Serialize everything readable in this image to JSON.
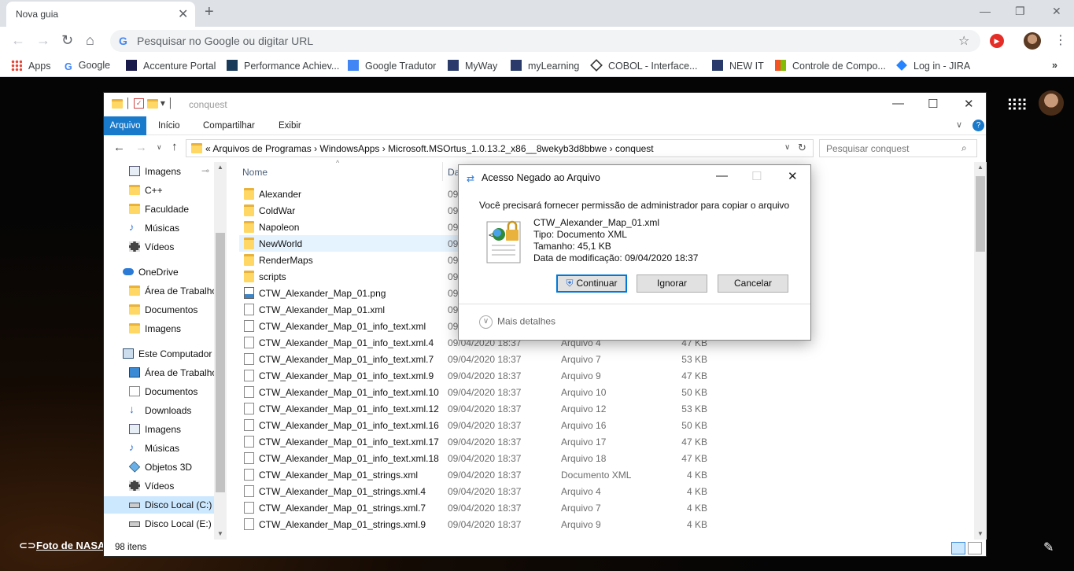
{
  "browser": {
    "tab_title": "Nova guia",
    "omnibox_placeholder": "Pesquisar no Google ou digitar URL",
    "bookmarks": [
      "Apps",
      "Google",
      "Accenture Portal",
      "Performance Achiev...",
      "Google Tradutor",
      "MyWay",
      "myLearning",
      "COBOL - Interface...",
      "NEW IT",
      "Controle de Compo...",
      "Log in - JIRA"
    ]
  },
  "desktop": {
    "photo_credit": "Foto de NASA"
  },
  "explorer": {
    "title": "conquest",
    "ribbon_tabs": [
      "Arquivo",
      "Início",
      "Compartilhar",
      "Exibir"
    ],
    "breadcrumb": "«  Arquivos de Programas  ›  WindowsApps  ›  Microsoft.MSOrtus_1.0.13.2_x86__8wekyb3d8bbwe  ›  conquest",
    "search_placeholder": "Pesquisar conquest",
    "nav": [
      "Imagens",
      "C++",
      "Faculdade",
      "Músicas",
      "Vídeos",
      "OneDrive",
      "Área de Trabalho",
      "Documentos",
      "Imagens",
      "Este Computador",
      "Área de Trabalho",
      "Documentos",
      "Downloads",
      "Imagens",
      "Músicas",
      "Objetos 3D",
      "Vídeos",
      "Disco Local (C:)",
      "Disco Local (E:)"
    ],
    "columns": {
      "name": "Nome",
      "date": "Da"
    },
    "files": [
      {
        "name": "Alexander",
        "date": "09",
        "type": "",
        "size": ""
      },
      {
        "name": "ColdWar",
        "date": "09",
        "type": "",
        "size": ""
      },
      {
        "name": "Napoleon",
        "date": "09",
        "type": "",
        "size": ""
      },
      {
        "name": "NewWorld",
        "date": "09",
        "type": "",
        "size": ""
      },
      {
        "name": "RenderMaps",
        "date": "09",
        "type": "",
        "size": ""
      },
      {
        "name": "scripts",
        "date": "09",
        "type": "",
        "size": ""
      },
      {
        "name": "CTW_Alexander_Map_01.png",
        "date": "09",
        "type": "",
        "size": ""
      },
      {
        "name": "CTW_Alexander_Map_01.xml",
        "date": "09",
        "type": "",
        "size": ""
      },
      {
        "name": "CTW_Alexander_Map_01_info_text.xml",
        "date": "09",
        "type": "",
        "size": ""
      },
      {
        "name": "CTW_Alexander_Map_01_info_text.xml.4",
        "date": "09/04/2020 18:37",
        "type": "Arquivo 4",
        "size": "47 KB"
      },
      {
        "name": "CTW_Alexander_Map_01_info_text.xml.7",
        "date": "09/04/2020 18:37",
        "type": "Arquivo 7",
        "size": "53 KB"
      },
      {
        "name": "CTW_Alexander_Map_01_info_text.xml.9",
        "date": "09/04/2020 18:37",
        "type": "Arquivo 9",
        "size": "47 KB"
      },
      {
        "name": "CTW_Alexander_Map_01_info_text.xml.10",
        "date": "09/04/2020 18:37",
        "type": "Arquivo 10",
        "size": "50 KB"
      },
      {
        "name": "CTW_Alexander_Map_01_info_text.xml.12",
        "date": "09/04/2020 18:37",
        "type": "Arquivo 12",
        "size": "53 KB"
      },
      {
        "name": "CTW_Alexander_Map_01_info_text.xml.16",
        "date": "09/04/2020 18:37",
        "type": "Arquivo 16",
        "size": "50 KB"
      },
      {
        "name": "CTW_Alexander_Map_01_info_text.xml.17",
        "date": "09/04/2020 18:37",
        "type": "Arquivo 17",
        "size": "47 KB"
      },
      {
        "name": "CTW_Alexander_Map_01_info_text.xml.18",
        "date": "09/04/2020 18:37",
        "type": "Arquivo 18",
        "size": "47 KB"
      },
      {
        "name": "CTW_Alexander_Map_01_strings.xml",
        "date": "09/04/2020 18:37",
        "type": "Documento XML",
        "size": "4 KB"
      },
      {
        "name": "CTW_Alexander_Map_01_strings.xml.4",
        "date": "09/04/2020 18:37",
        "type": "Arquivo 4",
        "size": "4 KB"
      },
      {
        "name": "CTW_Alexander_Map_01_strings.xml.7",
        "date": "09/04/2020 18:37",
        "type": "Arquivo 7",
        "size": "4 KB"
      },
      {
        "name": "CTW_Alexander_Map_01_strings.xml.9",
        "date": "09/04/2020 18:37",
        "type": "Arquivo 9",
        "size": "4 KB"
      }
    ],
    "item_count": "98 itens"
  },
  "dialog": {
    "title": "Acesso Negado ao Arquivo",
    "message": "Você precisará fornecer permissão de administrador para copiar o arquivo",
    "file_name": "CTW_Alexander_Map_01.xml",
    "file_type": "Tipo: Documento XML",
    "file_size": "Tamanho: 45,1 KB",
    "file_modified": "Data de modificação: 09/04/2020 18:37",
    "btn_continue": "Continuar",
    "btn_ignore": "Ignorar",
    "btn_cancel": "Cancelar",
    "more_details": "Mais detalhes"
  }
}
